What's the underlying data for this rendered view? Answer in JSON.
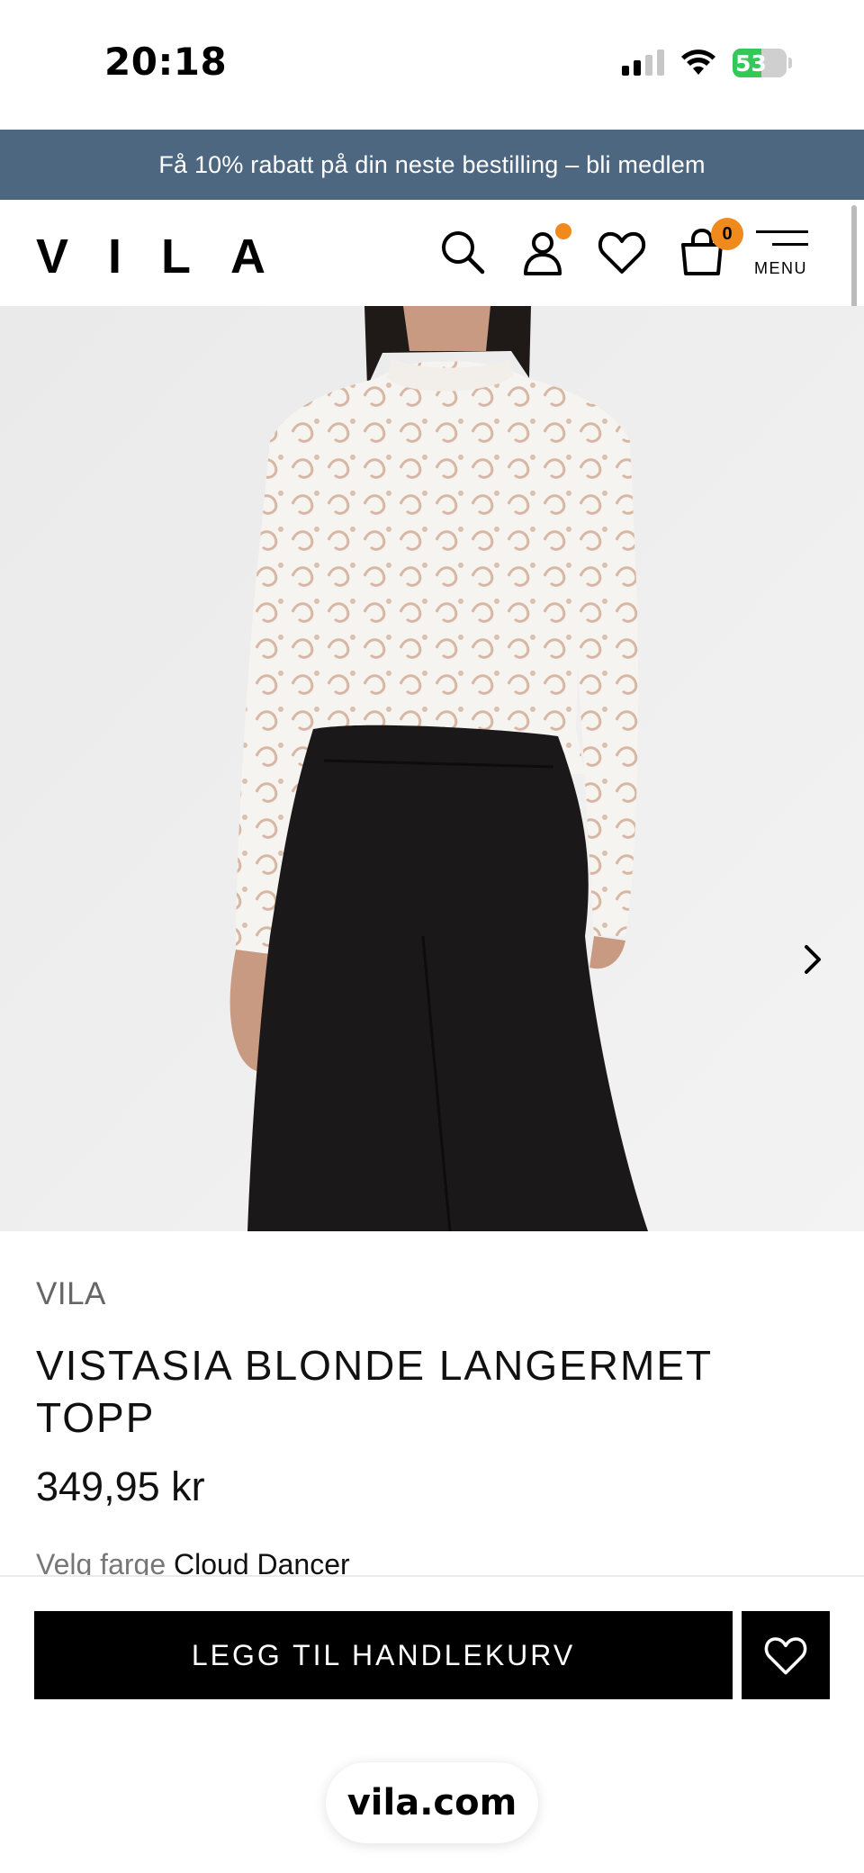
{
  "status_bar": {
    "time": "20:18",
    "battery_percent": "53",
    "battery_level": 0.53,
    "signal_bars_active": 2,
    "icons": [
      "signal-icon",
      "wifi-icon",
      "battery-icon"
    ]
  },
  "promo_banner": {
    "text": "Få 10% rabatt på din neste bestilling – bli medlem",
    "background": "#4e6780"
  },
  "header": {
    "logo": "VILA",
    "icons": [
      "search-icon",
      "account-icon",
      "heart-icon",
      "bag-icon"
    ],
    "account_has_notification": true,
    "cart_count": "0",
    "menu_label": "MENU",
    "badge_color": "#f08a1c"
  },
  "gallery": {
    "next_icon": "chevron-right-icon"
  },
  "product": {
    "brand": "VILA",
    "name": "VISTASIA BLONDE LANGERMET TOPP",
    "price": "349,95 kr",
    "color_label": "Velg farge",
    "color_value": "Cloud Dancer"
  },
  "actions": {
    "add_to_cart_label": "LEGG TIL HANDLEKURV",
    "wishlist_icon": "heart-icon"
  },
  "browser": {
    "url": "vila.com"
  }
}
